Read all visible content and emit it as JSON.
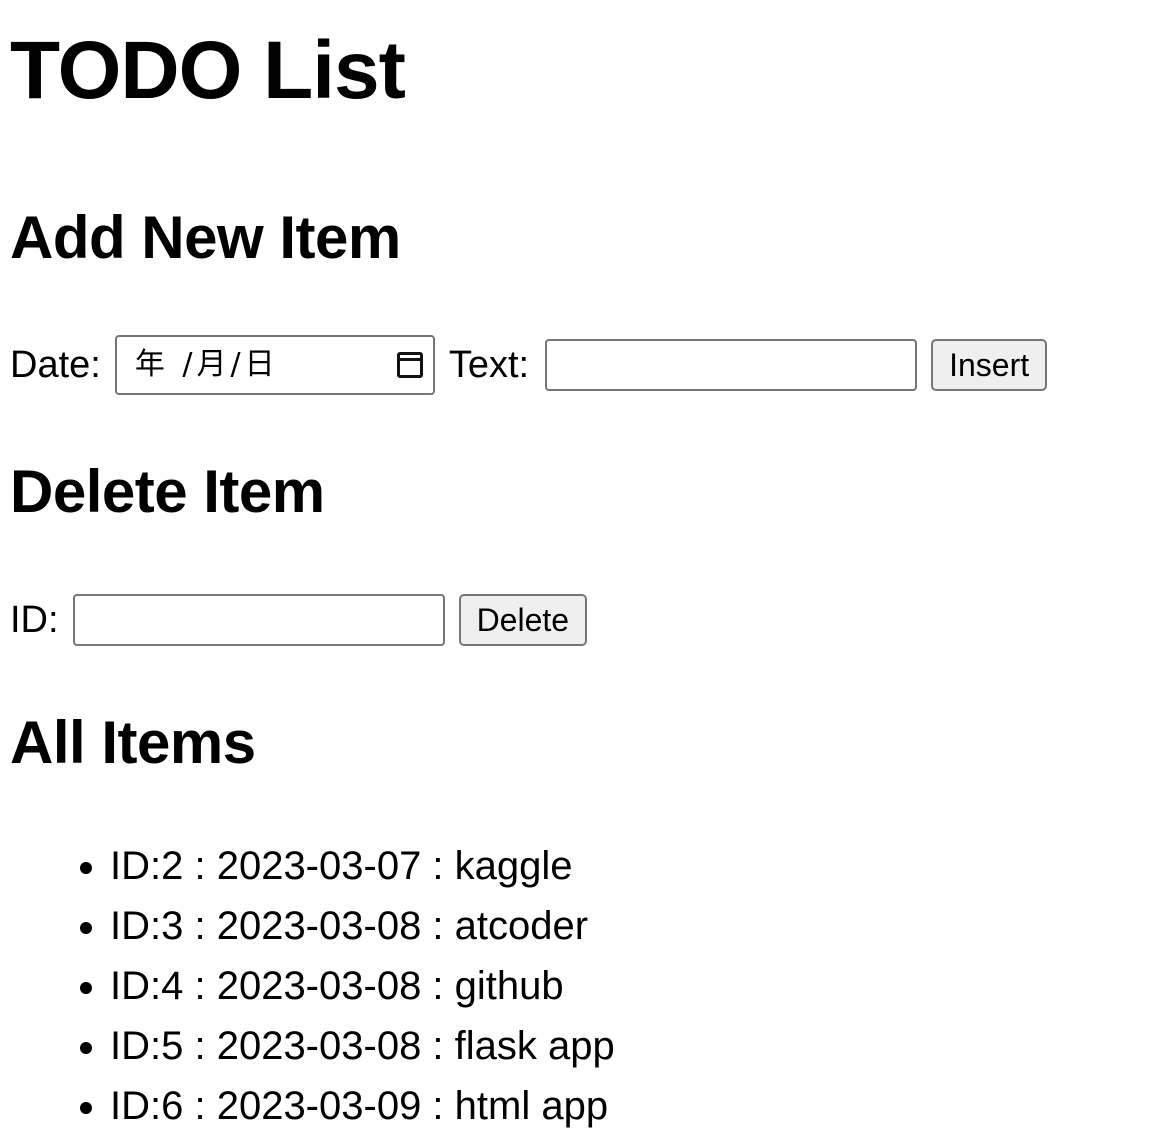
{
  "title": "TODO List",
  "add_section": {
    "heading": "Add New Item",
    "date_label": "Date:",
    "date_placeholder": "年 /月/日",
    "text_label": "Text:",
    "text_value": "",
    "insert_label": "Insert"
  },
  "delete_section": {
    "heading": "Delete Item",
    "id_label": "ID:",
    "id_value": "",
    "delete_label": "Delete"
  },
  "list_section": {
    "heading": "All Items",
    "items": [
      {
        "text": "ID:2 : 2023-03-07 : kaggle"
      },
      {
        "text": "ID:3 : 2023-03-08 : atcoder"
      },
      {
        "text": "ID:4 : 2023-03-08 : github"
      },
      {
        "text": "ID:5 : 2023-03-08 : flask app"
      },
      {
        "text": "ID:6 : 2023-03-09 : html app"
      }
    ]
  },
  "icons": {
    "date_picker": "calendar-icon"
  }
}
